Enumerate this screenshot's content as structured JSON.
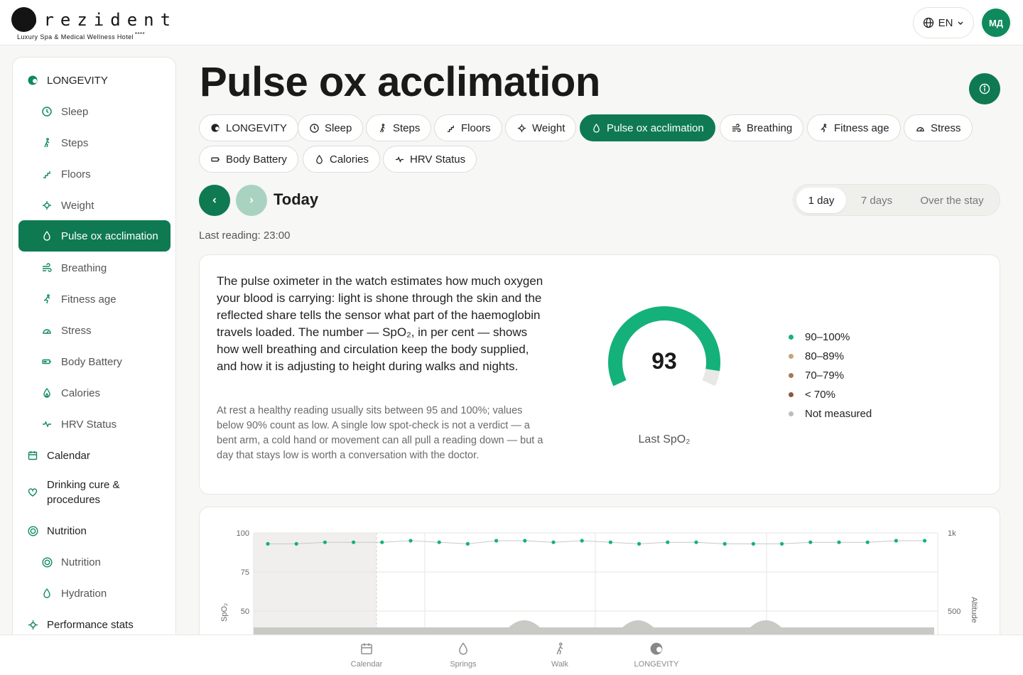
{
  "brand": {
    "name": "prezident",
    "tagline": "Luxury Spa & Medical Wellness Hotel",
    "stars": "****"
  },
  "header": {
    "language": "EN",
    "avatar_initials": "МД"
  },
  "sidebar": {
    "items": [
      {
        "label": "LONGEVITY",
        "icon": "longevity-icon"
      },
      {
        "label": "Sleep",
        "icon": "clock-icon"
      },
      {
        "label": "Steps",
        "icon": "walking-icon"
      },
      {
        "label": "Floors",
        "icon": "stairs-icon"
      },
      {
        "label": "Weight",
        "icon": "weight-icon"
      },
      {
        "label": "Pulse ox acclimation",
        "icon": "drop-icon",
        "active": true
      },
      {
        "label": "Breathing",
        "icon": "wind-icon"
      },
      {
        "label": "Fitness age",
        "icon": "running-icon"
      },
      {
        "label": "Stress",
        "icon": "gauge-icon"
      },
      {
        "label": "Body Battery",
        "icon": "battery-icon"
      },
      {
        "label": "Calories",
        "icon": "flame-icon"
      },
      {
        "label": "HRV Status",
        "icon": "pulse-icon"
      },
      {
        "label": "Calendar",
        "icon": "calendar-icon"
      },
      {
        "label": "Drinking cure &",
        "label2": "procedures",
        "icon": "heart-icon"
      },
      {
        "label": "Nutrition",
        "icon": "target-icon"
      },
      {
        "label": "Nutrition",
        "icon": "target-icon"
      },
      {
        "label": "Hydration",
        "icon": "drop-icon"
      },
      {
        "label": "Performance stats",
        "icon": "crosshair-icon"
      }
    ]
  },
  "page": {
    "title": "Pulse ox acclimation",
    "day_label": "Today",
    "last_reading": "Last reading: 23:00",
    "range": {
      "options": [
        "1 day",
        "7 days",
        "Over the stay"
      ],
      "selected": "1 day"
    }
  },
  "chips": [
    {
      "label": "LONGEVITY"
    },
    {
      "label": "Sleep"
    },
    {
      "label": "Steps"
    },
    {
      "label": "Floors"
    },
    {
      "label": "Weight"
    },
    {
      "label": "Pulse ox acclimation",
      "active": true
    },
    {
      "label": "Breathing"
    },
    {
      "label": "Fitness age"
    },
    {
      "label": "Stress"
    },
    {
      "label": "Body Battery"
    },
    {
      "label": "Calories"
    },
    {
      "label": "HRV Status"
    }
  ],
  "summary": {
    "description": "The pulse oximeter in the watch estimates how much oxygen your blood is carrying: light is shone through the skin and the reflected share tells the sensor what part of the haemoglobin travels loaded. The number — SpO₂, in per cent — shows how well breathing and circulation keep the body supplied, and how it is adjusting to height during walks and nights.",
    "note": "At rest a healthy reading usually sits between 95 and 100%; values below 90% count as low. A single low spot-check is not a verdict — a bent arm, a cold hand or movement can all pull a reading down — but a day that stays low is worth a conversation with the doctor.",
    "gauge_value": "93",
    "gauge_fraction": 0.93,
    "gauge_label": "Last SpO₂",
    "legend": [
      {
        "label": "90–100%",
        "color": "#14b27a"
      },
      {
        "label": "80–89%",
        "color": "#c9a27a"
      },
      {
        "label": "70–79%",
        "color": "#a67a55"
      },
      {
        "label": "< 70%",
        "color": "#8a5a3a"
      },
      {
        "label": "Not measured",
        "color": "#bdbdbd"
      }
    ]
  },
  "chart_data": {
    "type": "line",
    "ylabel": "SpO₂",
    "y2label": "Altitude",
    "yticks": [
      "100",
      "75",
      "50"
    ],
    "y2ticks": [
      "1k",
      "500"
    ],
    "series": [
      {
        "name": "SpO₂",
        "values": [
          93,
          93,
          94,
          94,
          94,
          95,
          94,
          93,
          95,
          95,
          94,
          95,
          94,
          93,
          94,
          94,
          93,
          93,
          93,
          94,
          94,
          94,
          95,
          95
        ]
      }
    ],
    "colors": {
      "spo2": "#14b27a",
      "line": "#c8c8c8",
      "altitude": "#c9c9c6",
      "night_shade": "#f0efed"
    }
  },
  "bottom_nav": [
    {
      "label": "Calendar",
      "icon": "calendar-icon"
    },
    {
      "label": "Springs",
      "icon": "drop-icon"
    },
    {
      "label": "Walk",
      "icon": "walking-icon"
    },
    {
      "label": "LONGEVITY",
      "icon": "longevity-icon"
    }
  ]
}
